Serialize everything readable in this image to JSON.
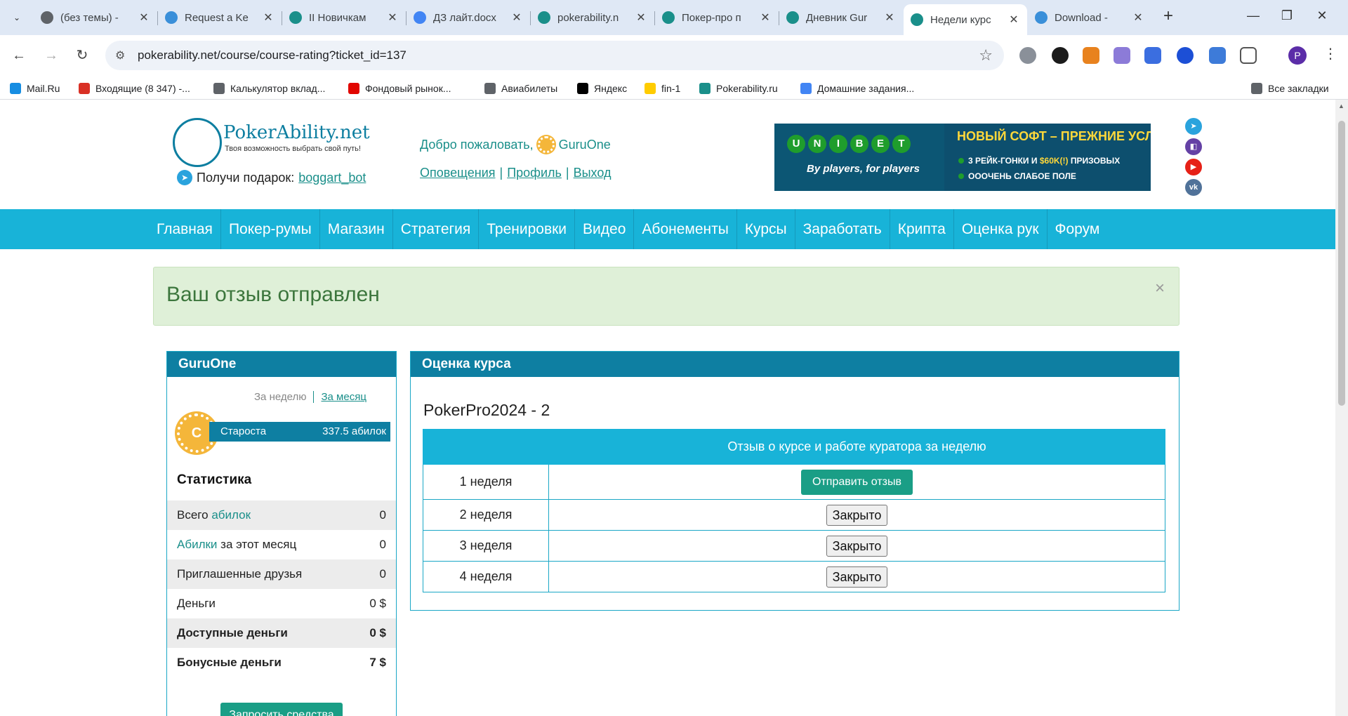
{
  "tabs": [
    {
      "title": "(без темы) - ",
      "icon": "globe-icon",
      "color": "#5f6368"
    },
    {
      "title": "Request a Ke",
      "icon": "swirl-icon",
      "color": "#3a8fd9"
    },
    {
      "title": "II Новичкам",
      "icon": "pokerability-icon",
      "color": "#1a8f8a"
    },
    {
      "title": "ДЗ лайт.docx",
      "icon": "docs-icon",
      "color": "#4285f4"
    },
    {
      "title": "pokerability.n",
      "icon": "pokerability-icon",
      "color": "#1a8f8a"
    },
    {
      "title": "Покер-про п",
      "icon": "pokerability-icon",
      "color": "#1a8f8a"
    },
    {
      "title": "Дневник Gur",
      "icon": "pokerability-icon",
      "color": "#1a8f8a"
    },
    {
      "title": "Недели курс",
      "icon": "pokerability-icon",
      "color": "#1a8f8a",
      "active": true
    },
    {
      "title": "Download - ",
      "icon": "swirl-icon",
      "color": "#3a8fd9"
    }
  ],
  "browser": {
    "url": "pokerability.net/course/course-rating?ticket_id=137",
    "profile_initial": "P"
  },
  "bookmarks": [
    {
      "label": "Mail.Ru",
      "icon": "mailru-icon",
      "color": "#168de2"
    },
    {
      "label": "Входящие (8 347) -...",
      "icon": "gmail-icon",
      "color": "#d93025"
    },
    {
      "label": "Калькулятор вклад...",
      "icon": "globe-icon",
      "color": "#5f6368"
    },
    {
      "label": "Фондовый рынок...",
      "icon": "flag-icon",
      "color": "#e10600"
    },
    {
      "label": "Авиабилеты",
      "icon": "globe-icon",
      "color": "#5f6368"
    },
    {
      "label": "Яндекс",
      "icon": "yandex-icon",
      "color": "#000000"
    },
    {
      "label": "fin-1",
      "icon": "m-icon",
      "color": "#ffcc00"
    },
    {
      "label": "Pokerability.ru",
      "icon": "pokerability-icon",
      "color": "#1a8f8a"
    },
    {
      "label": "Домашние задания...",
      "icon": "docs-icon",
      "color": "#4285f4"
    },
    {
      "label": "Все закладки",
      "icon": "folder-icon",
      "color": "#5f6368"
    }
  ],
  "header": {
    "logo_name": "PokerAbility.net",
    "logo_slogan": "Твоя возможность выбрать свой путь!",
    "gift_text": "Получи подарок:",
    "gift_link": "boggart_bot",
    "welcome": "Добро пожаловать,",
    "username": "GuruOne",
    "links": [
      "Оповещения",
      "Профиль",
      "Выход"
    ],
    "separator": "|"
  },
  "banner": {
    "brand_letters": [
      "U",
      "N",
      "I",
      "B",
      "E",
      "T"
    ],
    "tagline": "By players, for players",
    "headline": "НОВЫЙ СОФТ – ПРЕЖНИЕ УСЛОВИЯ:",
    "line1_a": "3 РЕЙК-ГОНКИ И ",
    "line1_b": "$60K(!)",
    "line1_c": " ПРИЗОВЫХ",
    "line2": "ОООЧЕНЬ СЛАБОЕ ПОЛЕ"
  },
  "social": [
    {
      "icon": "telegram-icon",
      "color": "#2aa3dd",
      "glyph": "➤"
    },
    {
      "icon": "twitch-icon",
      "color": "#6441a5",
      "glyph": "◧"
    },
    {
      "icon": "youtube-icon",
      "color": "#e62117",
      "glyph": "▶"
    },
    {
      "icon": "vk-icon",
      "color": "#507299",
      "glyph": "vk"
    }
  ],
  "nav": [
    "Главная",
    "Покер-румы",
    "Магазин",
    "Стратегия",
    "Тренировки",
    "Видео",
    "Абонементы",
    "Курсы",
    "Заработать",
    "Крипта",
    "Оценка рук",
    "Форум"
  ],
  "alert": {
    "message": "Ваш отзыв отправлен",
    "close": "×"
  },
  "sidebar": {
    "title": "GuruOne",
    "period_week": "За неделю",
    "period_month": "За месяц",
    "rank_letter": "C",
    "rank_name": "Староста",
    "rank_value": "337.5 абилок",
    "stats_title": "Статистика",
    "stats": [
      {
        "label_a": "Всего ",
        "label_link": "абилок",
        "label_b": "",
        "value": "0"
      },
      {
        "label_a": "",
        "label_link": "Абилки",
        "label_b": " за этот месяц",
        "value": "0"
      },
      {
        "label_a": "Приглашенные друзья",
        "label_link": "",
        "label_b": "",
        "value": "0"
      },
      {
        "label_a": "Деньги",
        "label_link": "",
        "label_b": "",
        "value": "0 $"
      },
      {
        "label_a": "Доступные деньги",
        "label_link": "",
        "label_b": "",
        "value": "0 $"
      },
      {
        "label_a": "Бонусные деньги",
        "label_link": "",
        "label_b": "",
        "value": "7 $"
      }
    ],
    "request_button": "Запросить средства"
  },
  "course": {
    "panel_title": "Оценка курса",
    "course_name": "PokerPro2024 - 2",
    "column_header": "Отзыв о курсе и работе куратора за неделю",
    "weeks": [
      {
        "label": "1 неделя",
        "action": "Отправить отзыв",
        "type": "send"
      },
      {
        "label": "2 неделя",
        "action": "Закрыто",
        "type": "closed"
      },
      {
        "label": "3 неделя",
        "action": "Закрыто",
        "type": "closed"
      },
      {
        "label": "4 неделя",
        "action": "Закрыто",
        "type": "closed"
      }
    ]
  }
}
